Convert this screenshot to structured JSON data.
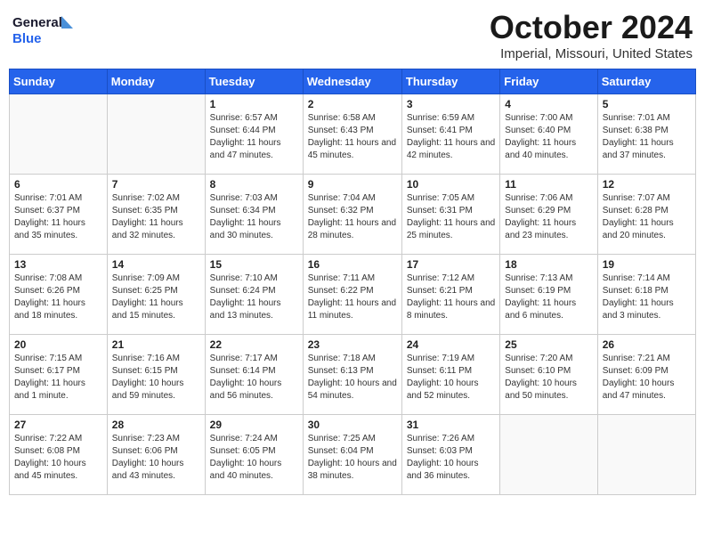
{
  "header": {
    "logo_general": "General",
    "logo_blue": "Blue",
    "title": "October 2024",
    "subtitle": "Imperial, Missouri, United States"
  },
  "days_of_week": [
    "Sunday",
    "Monday",
    "Tuesday",
    "Wednesday",
    "Thursday",
    "Friday",
    "Saturday"
  ],
  "weeks": [
    {
      "days": [
        {
          "num": "",
          "info": ""
        },
        {
          "num": "",
          "info": ""
        },
        {
          "num": "1",
          "info": "Sunrise: 6:57 AM\nSunset: 6:44 PM\nDaylight: 11 hours and 47 minutes."
        },
        {
          "num": "2",
          "info": "Sunrise: 6:58 AM\nSunset: 6:43 PM\nDaylight: 11 hours and 45 minutes."
        },
        {
          "num": "3",
          "info": "Sunrise: 6:59 AM\nSunset: 6:41 PM\nDaylight: 11 hours and 42 minutes."
        },
        {
          "num": "4",
          "info": "Sunrise: 7:00 AM\nSunset: 6:40 PM\nDaylight: 11 hours and 40 minutes."
        },
        {
          "num": "5",
          "info": "Sunrise: 7:01 AM\nSunset: 6:38 PM\nDaylight: 11 hours and 37 minutes."
        }
      ]
    },
    {
      "days": [
        {
          "num": "6",
          "info": "Sunrise: 7:01 AM\nSunset: 6:37 PM\nDaylight: 11 hours and 35 minutes."
        },
        {
          "num": "7",
          "info": "Sunrise: 7:02 AM\nSunset: 6:35 PM\nDaylight: 11 hours and 32 minutes."
        },
        {
          "num": "8",
          "info": "Sunrise: 7:03 AM\nSunset: 6:34 PM\nDaylight: 11 hours and 30 minutes."
        },
        {
          "num": "9",
          "info": "Sunrise: 7:04 AM\nSunset: 6:32 PM\nDaylight: 11 hours and 28 minutes."
        },
        {
          "num": "10",
          "info": "Sunrise: 7:05 AM\nSunset: 6:31 PM\nDaylight: 11 hours and 25 minutes."
        },
        {
          "num": "11",
          "info": "Sunrise: 7:06 AM\nSunset: 6:29 PM\nDaylight: 11 hours and 23 minutes."
        },
        {
          "num": "12",
          "info": "Sunrise: 7:07 AM\nSunset: 6:28 PM\nDaylight: 11 hours and 20 minutes."
        }
      ]
    },
    {
      "days": [
        {
          "num": "13",
          "info": "Sunrise: 7:08 AM\nSunset: 6:26 PM\nDaylight: 11 hours and 18 minutes."
        },
        {
          "num": "14",
          "info": "Sunrise: 7:09 AM\nSunset: 6:25 PM\nDaylight: 11 hours and 15 minutes."
        },
        {
          "num": "15",
          "info": "Sunrise: 7:10 AM\nSunset: 6:24 PM\nDaylight: 11 hours and 13 minutes."
        },
        {
          "num": "16",
          "info": "Sunrise: 7:11 AM\nSunset: 6:22 PM\nDaylight: 11 hours and 11 minutes."
        },
        {
          "num": "17",
          "info": "Sunrise: 7:12 AM\nSunset: 6:21 PM\nDaylight: 11 hours and 8 minutes."
        },
        {
          "num": "18",
          "info": "Sunrise: 7:13 AM\nSunset: 6:19 PM\nDaylight: 11 hours and 6 minutes."
        },
        {
          "num": "19",
          "info": "Sunrise: 7:14 AM\nSunset: 6:18 PM\nDaylight: 11 hours and 3 minutes."
        }
      ]
    },
    {
      "days": [
        {
          "num": "20",
          "info": "Sunrise: 7:15 AM\nSunset: 6:17 PM\nDaylight: 11 hours and 1 minute."
        },
        {
          "num": "21",
          "info": "Sunrise: 7:16 AM\nSunset: 6:15 PM\nDaylight: 10 hours and 59 minutes."
        },
        {
          "num": "22",
          "info": "Sunrise: 7:17 AM\nSunset: 6:14 PM\nDaylight: 10 hours and 56 minutes."
        },
        {
          "num": "23",
          "info": "Sunrise: 7:18 AM\nSunset: 6:13 PM\nDaylight: 10 hours and 54 minutes."
        },
        {
          "num": "24",
          "info": "Sunrise: 7:19 AM\nSunset: 6:11 PM\nDaylight: 10 hours and 52 minutes."
        },
        {
          "num": "25",
          "info": "Sunrise: 7:20 AM\nSunset: 6:10 PM\nDaylight: 10 hours and 50 minutes."
        },
        {
          "num": "26",
          "info": "Sunrise: 7:21 AM\nSunset: 6:09 PM\nDaylight: 10 hours and 47 minutes."
        }
      ]
    },
    {
      "days": [
        {
          "num": "27",
          "info": "Sunrise: 7:22 AM\nSunset: 6:08 PM\nDaylight: 10 hours and 45 minutes."
        },
        {
          "num": "28",
          "info": "Sunrise: 7:23 AM\nSunset: 6:06 PM\nDaylight: 10 hours and 43 minutes."
        },
        {
          "num": "29",
          "info": "Sunrise: 7:24 AM\nSunset: 6:05 PM\nDaylight: 10 hours and 40 minutes."
        },
        {
          "num": "30",
          "info": "Sunrise: 7:25 AM\nSunset: 6:04 PM\nDaylight: 10 hours and 38 minutes."
        },
        {
          "num": "31",
          "info": "Sunrise: 7:26 AM\nSunset: 6:03 PM\nDaylight: 10 hours and 36 minutes."
        },
        {
          "num": "",
          "info": ""
        },
        {
          "num": "",
          "info": ""
        }
      ]
    }
  ]
}
